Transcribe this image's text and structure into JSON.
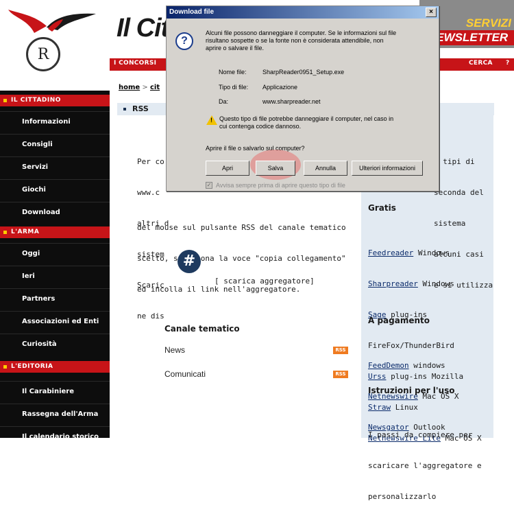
{
  "header": {
    "site_title": "Il Cit",
    "banner_top": "SERVIZI",
    "banner_bottom": "NEWSLETTER",
    "emblem_text": "R"
  },
  "topnav": {
    "left": "I CONCORSI",
    "cerca": "CERCA",
    "help": "?"
  },
  "sidebar": {
    "sections": [
      {
        "label": "IL CITTADINO",
        "items": [
          "Informazioni",
          "Consigli",
          "Servizi",
          "Giochi",
          "Download"
        ]
      },
      {
        "label": "L'ARMA",
        "items": [
          "Oggi",
          "Ieri",
          "Partners",
          "Associazioni ed Enti",
          "Curiosità"
        ]
      },
      {
        "label": "L'EDITORIA",
        "items": [
          "Il Carabiniere",
          "Rassegna dell'Arma",
          "Il calendario storico"
        ]
      }
    ]
  },
  "breadcrumb": {
    "home": "home",
    "sep": ">",
    "current": "cit"
  },
  "main": {
    "section_title": "RSS",
    "paragraph_left": [
      "Per co",
      "www.c",
      "altri d",
      "sistem",
      "Scaric",
      "ne dis"
    ],
    "paragraph_full": [
      "del mouse sul pulsante RSS del canale tematico",
      "scelto, seleziona la voce \"copia collegamento\"",
      "ed incolla il link nell'aggregatore."
    ],
    "right_overlap": [
      "i tipi di",
      "seconda del",
      "sistema",
      "alcuni casi",
      "e si utilizza"
    ],
    "aggregator_link": "[ scarica aggregatore]",
    "channel_heading": "Canale tematico",
    "channels": [
      {
        "name": "News",
        "badge": "RSS"
      },
      {
        "name": "Comunicati",
        "badge": "RSS"
      }
    ]
  },
  "right_panel": {
    "gratis_heading": "Gratis",
    "gratis_items": [
      {
        "link": "Feedreader",
        "rest": " Windows"
      },
      {
        "link": "Sharpreader",
        "rest": " Windows"
      },
      {
        "link": "Sage",
        "rest": " plug-ins"
      },
      {
        "link": "",
        "rest": "FireFox/ThunderBird"
      },
      {
        "link": "Urss",
        "rest": " plug-ins Mozilla"
      },
      {
        "link": "Straw",
        "rest": " Linux"
      },
      {
        "link": "Netnewswire Lite",
        "rest": " Mac OS X"
      }
    ],
    "paid_heading": "A pagamento",
    "paid_items": [
      {
        "link": "FeedDemon",
        "rest": " windows"
      },
      {
        "link": "Netnewswire",
        "rest": " Mac OS X"
      },
      {
        "link": "Newsgator",
        "rest": " Outlook"
      }
    ],
    "instructions_heading": "Istruzioni per l'uso",
    "instructions_text": [
      "I passi da compiere per",
      "scaricare l'aggregatore e",
      "personalizzarlo"
    ]
  },
  "dialog": {
    "title": "Download file",
    "close": "×",
    "warning_lines": [
      "Alcuni file possono danneggiare il computer. Se le informazioni sul file",
      "risultano sospette o se la fonte non è considerata attendibile, non",
      "aprire o salvare il file."
    ],
    "file_name_label": "Nome file:",
    "file_name": "SharpReader0951_Setup.exe",
    "file_type_label": "Tipo di file:",
    "file_type": "Applicazione",
    "from_label": "Da:",
    "from": "www.sharpreader.net",
    "danger_lines": [
      "Questo tipo di file potrebbe danneggiare il computer, nel caso in",
      "cui contenga codice dannoso."
    ],
    "question": "Aprire il file o salvarlo sul computer?",
    "buttons": {
      "open": "Apri",
      "save": "Salva",
      "cancel": "Annulla",
      "more": "Ulteriori informazioni"
    },
    "checkbox_label": "Avvisa sempre prima di aprire questo tipo di file",
    "checkbox_mark": "✓"
  }
}
